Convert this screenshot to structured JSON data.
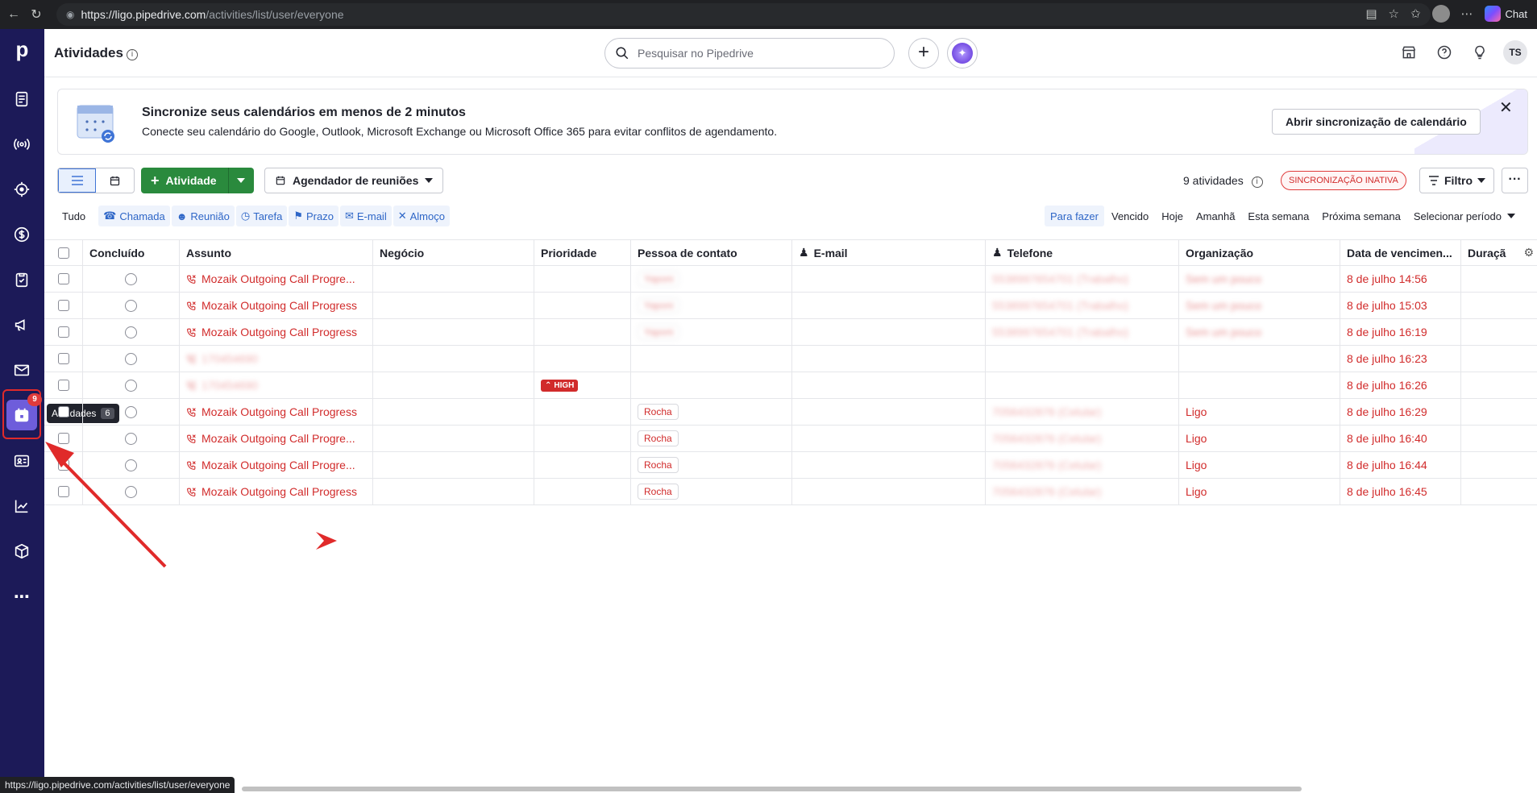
{
  "browser": {
    "url_host": "https://ligo.pipedrive.com",
    "url_path": "/activities/list/user/everyone",
    "chat_label": "Chat"
  },
  "sidebar": {
    "logo": "p",
    "badge_count": "9",
    "tooltip_label": "Atividades",
    "tooltip_count": "6"
  },
  "header": {
    "title": "Atividades",
    "info": "i",
    "search_placeholder": "Pesquisar no Pipedrive",
    "avatar_initials": "TS"
  },
  "banner": {
    "title": "Sincronize seus calendários em menos de 2 minutos",
    "subtitle": "Conecte seu calendário do Google, Outlook, Microsoft Exchange ou Microsoft Office 365 para evitar conflitos de agendamento.",
    "button": "Abrir sincronização de calendário"
  },
  "toolbar": {
    "add_label": "Atividade",
    "scheduler_label": "Agendador de reuniões",
    "count": "9 atividades",
    "sync_status": "SINCRONIZAÇÃO INATIVA",
    "filter_label": "Filtro",
    "more": "···"
  },
  "types": {
    "all": "Tudo",
    "call": "Chamada",
    "meeting": "Reunião",
    "task": "Tarefa",
    "deadline": "Prazo",
    "email": "E-mail",
    "lunch": "Almoço"
  },
  "periods": {
    "todo": "Para fazer",
    "overdue": "Vencido",
    "today": "Hoje",
    "tomorrow": "Amanhã",
    "this_week": "Esta semana",
    "next_week": "Próxima semana",
    "select": "Selecionar período"
  },
  "columns": {
    "done": "Concluído",
    "subject": "Assunto",
    "deal": "Negócio",
    "priority": "Prioridade",
    "contact": "Pessoa de contato",
    "email": "E-mail",
    "phone": "Telefone",
    "org": "Organização",
    "due": "Data de vencimen...",
    "duration": "Duraçã"
  },
  "rows": [
    {
      "subject": "Mozaik Outgoing Call Progre...",
      "contact": "Yaponi",
      "phone": "5538997654701 (Trabalho)",
      "org": "Sem um pouco",
      "due": "8 de julho 14:56"
    },
    {
      "subject": "Mozaik Outgoing Call Progress",
      "contact": "Yaponi",
      "phone": "5538997654701 (Trabalho)",
      "org": "Sem um pouco",
      "due": "8 de julho 15:03"
    },
    {
      "subject": "Mozaik Outgoing Call Progress",
      "contact": "Yaponi",
      "phone": "5538997654701 (Trabalho)",
      "org": "Sem um pouco",
      "due": "8 de julho 16:19"
    },
    {
      "subject": "170454690",
      "due": "8 de julho 16:23"
    },
    {
      "subject": "170454690",
      "priority": "HIGH",
      "due": "8 de julho 16:26"
    },
    {
      "subject": "Mozaik Outgoing Call Progress",
      "contact": "Rocha",
      "phone": "7056432876 (Celular)",
      "org": "Ligo",
      "due": "8 de julho 16:29"
    },
    {
      "subject": "Mozaik Outgoing Call Progre...",
      "contact": "Rocha",
      "phone": "7056432876 (Celular)",
      "org": "Ligo",
      "due": "8 de julho 16:40"
    },
    {
      "subject": "Mozaik Outgoing Call Progre...",
      "contact": "Rocha",
      "phone": "7056432876 (Celular)",
      "org": "Ligo",
      "due": "8 de julho 16:44"
    },
    {
      "subject": "Mozaik Outgoing Call Progress",
      "contact": "Rocha",
      "phone": "7056432876 (Celular)",
      "org": "Ligo",
      "due": "8 de julho 16:45"
    }
  ],
  "statusbar": "https://ligo.pipedrive.com/activities/list/user/everyone",
  "colors": {
    "sidebar": "#1c1a58",
    "accent_green": "#2a8a3d",
    "overdue_red": "#d12b2b",
    "annotation_red": "#e02a2a"
  }
}
